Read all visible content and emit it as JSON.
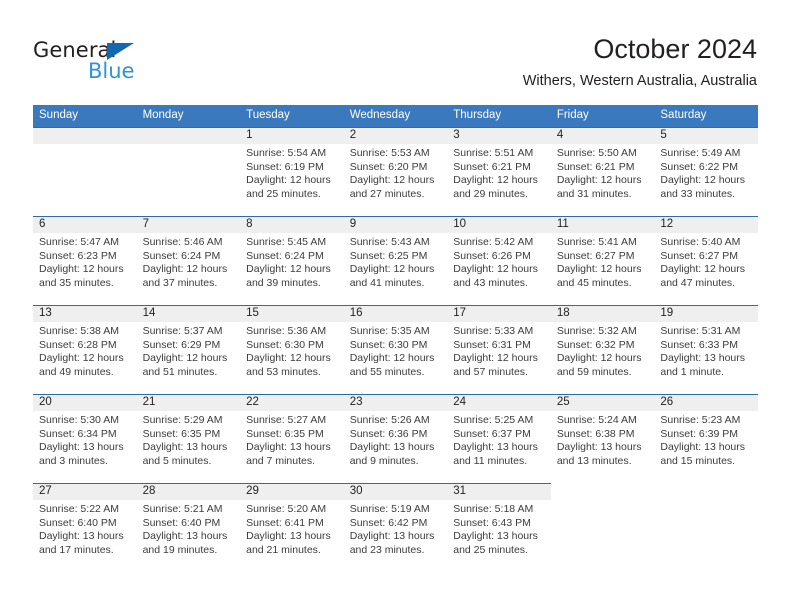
{
  "brand": {
    "name_part1": "General",
    "name_part2": "Blue",
    "triangle_color": "#1268b3",
    "blue_color": "#2e93d9"
  },
  "header": {
    "title": "October 2024",
    "subtitle": "Withers, Western Australia, Australia"
  },
  "theme": {
    "header_blue": "#3a79bd",
    "separator_blue": "#2b6cab",
    "daynum_band": "#efeff0",
    "text": "#231f20"
  },
  "weekday_headers": [
    "Sunday",
    "Monday",
    "Tuesday",
    "Wednesday",
    "Thursday",
    "Friday",
    "Saturday"
  ],
  "labels": {
    "sunrise_prefix": "Sunrise:",
    "sunset_prefix": "Sunset:",
    "daylight_prefix": "Daylight:"
  },
  "weeks": [
    [
      {
        "day": "",
        "sunrise": "",
        "sunset": "",
        "daylight_line1": "",
        "daylight_line2": "",
        "empty": true,
        "trailing": false
      },
      {
        "day": "",
        "sunrise": "",
        "sunset": "",
        "daylight_line1": "",
        "daylight_line2": "",
        "empty": true,
        "trailing": false
      },
      {
        "day": "1",
        "sunrise": "Sunrise: 5:54 AM",
        "sunset": "Sunset: 6:19 PM",
        "daylight_line1": "Daylight: 12 hours",
        "daylight_line2": "and 25 minutes.",
        "empty": false,
        "trailing": false
      },
      {
        "day": "2",
        "sunrise": "Sunrise: 5:53 AM",
        "sunset": "Sunset: 6:20 PM",
        "daylight_line1": "Daylight: 12 hours",
        "daylight_line2": "and 27 minutes.",
        "empty": false,
        "trailing": false
      },
      {
        "day": "3",
        "sunrise": "Sunrise: 5:51 AM",
        "sunset": "Sunset: 6:21 PM",
        "daylight_line1": "Daylight: 12 hours",
        "daylight_line2": "and 29 minutes.",
        "empty": false,
        "trailing": false
      },
      {
        "day": "4",
        "sunrise": "Sunrise: 5:50 AM",
        "sunset": "Sunset: 6:21 PM",
        "daylight_line1": "Daylight: 12 hours",
        "daylight_line2": "and 31 minutes.",
        "empty": false,
        "trailing": false
      },
      {
        "day": "5",
        "sunrise": "Sunrise: 5:49 AM",
        "sunset": "Sunset: 6:22 PM",
        "daylight_line1": "Daylight: 12 hours",
        "daylight_line2": "and 33 minutes.",
        "empty": false,
        "trailing": false
      }
    ],
    [
      {
        "day": "6",
        "sunrise": "Sunrise: 5:47 AM",
        "sunset": "Sunset: 6:23 PM",
        "daylight_line1": "Daylight: 12 hours",
        "daylight_line2": "and 35 minutes.",
        "empty": false,
        "trailing": false
      },
      {
        "day": "7",
        "sunrise": "Sunrise: 5:46 AM",
        "sunset": "Sunset: 6:24 PM",
        "daylight_line1": "Daylight: 12 hours",
        "daylight_line2": "and 37 minutes.",
        "empty": false,
        "trailing": false
      },
      {
        "day": "8",
        "sunrise": "Sunrise: 5:45 AM",
        "sunset": "Sunset: 6:24 PM",
        "daylight_line1": "Daylight: 12 hours",
        "daylight_line2": "and 39 minutes.",
        "empty": false,
        "trailing": false
      },
      {
        "day": "9",
        "sunrise": "Sunrise: 5:43 AM",
        "sunset": "Sunset: 6:25 PM",
        "daylight_line1": "Daylight: 12 hours",
        "daylight_line2": "and 41 minutes.",
        "empty": false,
        "trailing": false
      },
      {
        "day": "10",
        "sunrise": "Sunrise: 5:42 AM",
        "sunset": "Sunset: 6:26 PM",
        "daylight_line1": "Daylight: 12 hours",
        "daylight_line2": "and 43 minutes.",
        "empty": false,
        "trailing": false
      },
      {
        "day": "11",
        "sunrise": "Sunrise: 5:41 AM",
        "sunset": "Sunset: 6:27 PM",
        "daylight_line1": "Daylight: 12 hours",
        "daylight_line2": "and 45 minutes.",
        "empty": false,
        "trailing": false
      },
      {
        "day": "12",
        "sunrise": "Sunrise: 5:40 AM",
        "sunset": "Sunset: 6:27 PM",
        "daylight_line1": "Daylight: 12 hours",
        "daylight_line2": "and 47 minutes.",
        "empty": false,
        "trailing": false
      }
    ],
    [
      {
        "day": "13",
        "sunrise": "Sunrise: 5:38 AM",
        "sunset": "Sunset: 6:28 PM",
        "daylight_line1": "Daylight: 12 hours",
        "daylight_line2": "and 49 minutes.",
        "empty": false,
        "trailing": false
      },
      {
        "day": "14",
        "sunrise": "Sunrise: 5:37 AM",
        "sunset": "Sunset: 6:29 PM",
        "daylight_line1": "Daylight: 12 hours",
        "daylight_line2": "and 51 minutes.",
        "empty": false,
        "trailing": false
      },
      {
        "day": "15",
        "sunrise": "Sunrise: 5:36 AM",
        "sunset": "Sunset: 6:30 PM",
        "daylight_line1": "Daylight: 12 hours",
        "daylight_line2": "and 53 minutes.",
        "empty": false,
        "trailing": false
      },
      {
        "day": "16",
        "sunrise": "Sunrise: 5:35 AM",
        "sunset": "Sunset: 6:30 PM",
        "daylight_line1": "Daylight: 12 hours",
        "daylight_line2": "and 55 minutes.",
        "empty": false,
        "trailing": false
      },
      {
        "day": "17",
        "sunrise": "Sunrise: 5:33 AM",
        "sunset": "Sunset: 6:31 PM",
        "daylight_line1": "Daylight: 12 hours",
        "daylight_line2": "and 57 minutes.",
        "empty": false,
        "trailing": false
      },
      {
        "day": "18",
        "sunrise": "Sunrise: 5:32 AM",
        "sunset": "Sunset: 6:32 PM",
        "daylight_line1": "Daylight: 12 hours",
        "daylight_line2": "and 59 minutes.",
        "empty": false,
        "trailing": false
      },
      {
        "day": "19",
        "sunrise": "Sunrise: 5:31 AM",
        "sunset": "Sunset: 6:33 PM",
        "daylight_line1": "Daylight: 13 hours",
        "daylight_line2": "and 1 minute.",
        "empty": false,
        "trailing": false
      }
    ],
    [
      {
        "day": "20",
        "sunrise": "Sunrise: 5:30 AM",
        "sunset": "Sunset: 6:34 PM",
        "daylight_line1": "Daylight: 13 hours",
        "daylight_line2": "and 3 minutes.",
        "empty": false,
        "trailing": false
      },
      {
        "day": "21",
        "sunrise": "Sunrise: 5:29 AM",
        "sunset": "Sunset: 6:35 PM",
        "daylight_line1": "Daylight: 13 hours",
        "daylight_line2": "and 5 minutes.",
        "empty": false,
        "trailing": false
      },
      {
        "day": "22",
        "sunrise": "Sunrise: 5:27 AM",
        "sunset": "Sunset: 6:35 PM",
        "daylight_line1": "Daylight: 13 hours",
        "daylight_line2": "and 7 minutes.",
        "empty": false,
        "trailing": false
      },
      {
        "day": "23",
        "sunrise": "Sunrise: 5:26 AM",
        "sunset": "Sunset: 6:36 PM",
        "daylight_line1": "Daylight: 13 hours",
        "daylight_line2": "and 9 minutes.",
        "empty": false,
        "trailing": false
      },
      {
        "day": "24",
        "sunrise": "Sunrise: 5:25 AM",
        "sunset": "Sunset: 6:37 PM",
        "daylight_line1": "Daylight: 13 hours",
        "daylight_line2": "and 11 minutes.",
        "empty": false,
        "trailing": false
      },
      {
        "day": "25",
        "sunrise": "Sunrise: 5:24 AM",
        "sunset": "Sunset: 6:38 PM",
        "daylight_line1": "Daylight: 13 hours",
        "daylight_line2": "and 13 minutes.",
        "empty": false,
        "trailing": false
      },
      {
        "day": "26",
        "sunrise": "Sunrise: 5:23 AM",
        "sunset": "Sunset: 6:39 PM",
        "daylight_line1": "Daylight: 13 hours",
        "daylight_line2": "and 15 minutes.",
        "empty": false,
        "trailing": false
      }
    ],
    [
      {
        "day": "27",
        "sunrise": "Sunrise: 5:22 AM",
        "sunset": "Sunset: 6:40 PM",
        "daylight_line1": "Daylight: 13 hours",
        "daylight_line2": "and 17 minutes.",
        "empty": false,
        "trailing": false
      },
      {
        "day": "28",
        "sunrise": "Sunrise: 5:21 AM",
        "sunset": "Sunset: 6:40 PM",
        "daylight_line1": "Daylight: 13 hours",
        "daylight_line2": "and 19 minutes.",
        "empty": false,
        "trailing": false
      },
      {
        "day": "29",
        "sunrise": "Sunrise: 5:20 AM",
        "sunset": "Sunset: 6:41 PM",
        "daylight_line1": "Daylight: 13 hours",
        "daylight_line2": "and 21 minutes.",
        "empty": false,
        "trailing": false
      },
      {
        "day": "30",
        "sunrise": "Sunrise: 5:19 AM",
        "sunset": "Sunset: 6:42 PM",
        "daylight_line1": "Daylight: 13 hours",
        "daylight_line2": "and 23 minutes.",
        "empty": false,
        "trailing": false
      },
      {
        "day": "31",
        "sunrise": "Sunrise: 5:18 AM",
        "sunset": "Sunset: 6:43 PM",
        "daylight_line1": "Daylight: 13 hours",
        "daylight_line2": "and 25 minutes.",
        "empty": false,
        "trailing": false
      },
      {
        "day": "",
        "sunrise": "",
        "sunset": "",
        "daylight_line1": "",
        "daylight_line2": "",
        "empty": true,
        "trailing": true
      },
      {
        "day": "",
        "sunrise": "",
        "sunset": "",
        "daylight_line1": "",
        "daylight_line2": "",
        "empty": true,
        "trailing": true
      }
    ]
  ]
}
